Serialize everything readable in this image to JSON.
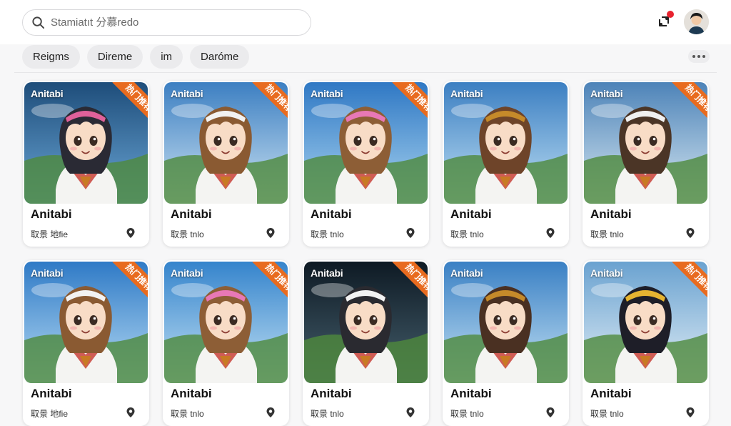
{
  "search": {
    "placeholder": "Stamiatıt 分慕redo"
  },
  "chips": [
    "Reigms",
    "Direme",
    "im",
    "Daróme"
  ],
  "cards": [
    {
      "brand": "Anitabi",
      "ribbon": "热门推荐",
      "title": "Anitabi",
      "subtitle": "取景 地fie",
      "hair": "#2a2a34",
      "band": "#e0619a",
      "sky1": "#1e4d7a",
      "sky2": "#6aa6d6"
    },
    {
      "brand": "Anitabi",
      "ribbon": "热门推荐",
      "title": "Anitabi",
      "subtitle": "取景 tnlo",
      "hair": "#8a5a32",
      "band": "#f2f2f2",
      "sky1": "#3c7fc2",
      "sky2": "#cde3f2"
    },
    {
      "brand": "Anitabi",
      "ribbon": "热门推荐",
      "title": "Anitabi",
      "subtitle": "取景 tnlo",
      "hair": "#8d5e36",
      "band": "#e878b6",
      "sky1": "#2f78c4",
      "sky2": "#a9d4f0"
    },
    {
      "brand": "Anitabi",
      "ribbon": "",
      "title": "Anitabi",
      "subtitle": "取景 tnlo",
      "hair": "#6e4429",
      "band": "#c58a2a",
      "sky1": "#3c7fc2",
      "sky2": "#bfe0f4"
    },
    {
      "brand": "Anitabi",
      "ribbon": "热门推荐",
      "title": "Anitabi",
      "subtitle": "取景 tnlo",
      "hair": "#4b3526",
      "band": "#f0f0f0",
      "sky1": "#4d83b8",
      "sky2": "#d7e8f2"
    },
    {
      "brand": "Anitabi",
      "ribbon": "热门推荐",
      "title": "Anitabi",
      "subtitle": "取景 地fie",
      "hair": "#8a5a32",
      "band": "#f2f2f2",
      "sky1": "#2f7ac6",
      "sky2": "#b6dbf4"
    },
    {
      "brand": "Anitabi",
      "ribbon": "热门推荐",
      "title": "Anitabi",
      "subtitle": "取景 tnlo",
      "hair": "#8d5e36",
      "band": "#e878b6",
      "sky1": "#3584cc",
      "sky2": "#c2e1f4"
    },
    {
      "brand": "Anitabi",
      "ribbon": "热门推荐",
      "title": "Anitabi",
      "subtitle": "取景 tnlo",
      "hair": "#2a2a30",
      "band": "#f2f2f2",
      "sky1": "#0e1a24",
      "sky2": "#46606e"
    },
    {
      "brand": "Anitabi",
      "ribbon": "",
      "title": "Anitabi",
      "subtitle": "取景 tnlo",
      "hair": "#4a3022",
      "band": "#c58a2a",
      "sky1": "#3a80c4",
      "sky2": "#c4e2f4"
    },
    {
      "brand": "Anitabi",
      "ribbon": "热门推荐",
      "title": "Anitabi",
      "subtitle": "取景 tnlo",
      "hair": "#1e1e28",
      "band": "#e6b431",
      "sky1": "#6aa2d0",
      "sky2": "#e2eef6"
    }
  ],
  "colors": {
    "accent": "#e86b1f",
    "notification": "#e8232f"
  },
  "icons": {
    "search": "search-icon",
    "notifications": "share-bell-icon",
    "more": "more-dots-icon",
    "pin": "location-pin-icon"
  }
}
